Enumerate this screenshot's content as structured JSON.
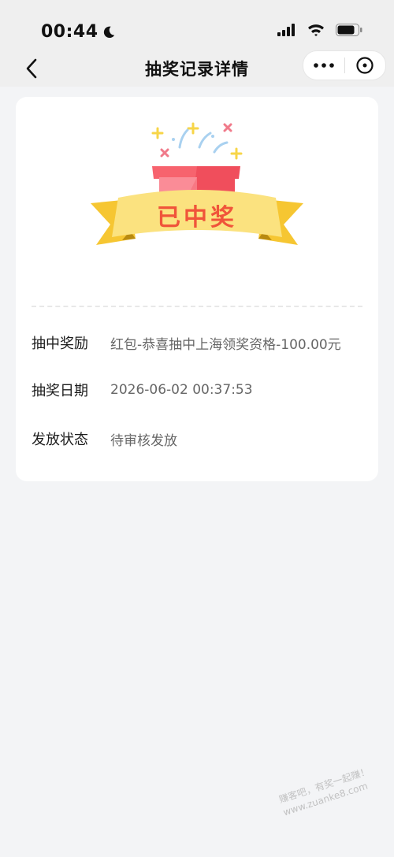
{
  "status_bar": {
    "time": "00:44"
  },
  "nav": {
    "title": "抽奖记录详情"
  },
  "prize": {
    "badge_text": "已中奖"
  },
  "details": [
    {
      "label": "抽中奖励",
      "value": "红包-恭喜抽中上海领奖资格-100.00元"
    },
    {
      "label": "抽奖日期",
      "value": "2026-06-02 00:37:53"
    },
    {
      "label": "发放状态",
      "value": "待审核发放"
    }
  ],
  "watermark": {
    "line1": "赚客吧，有奖一起赚！",
    "line2": "www.zuanke8.com"
  },
  "colors": {
    "background": "#f3f4f6",
    "card": "#ffffff",
    "badge_text": "#f0543a",
    "ribbon": "#fbe27f",
    "gift_box": "#f4525f"
  }
}
